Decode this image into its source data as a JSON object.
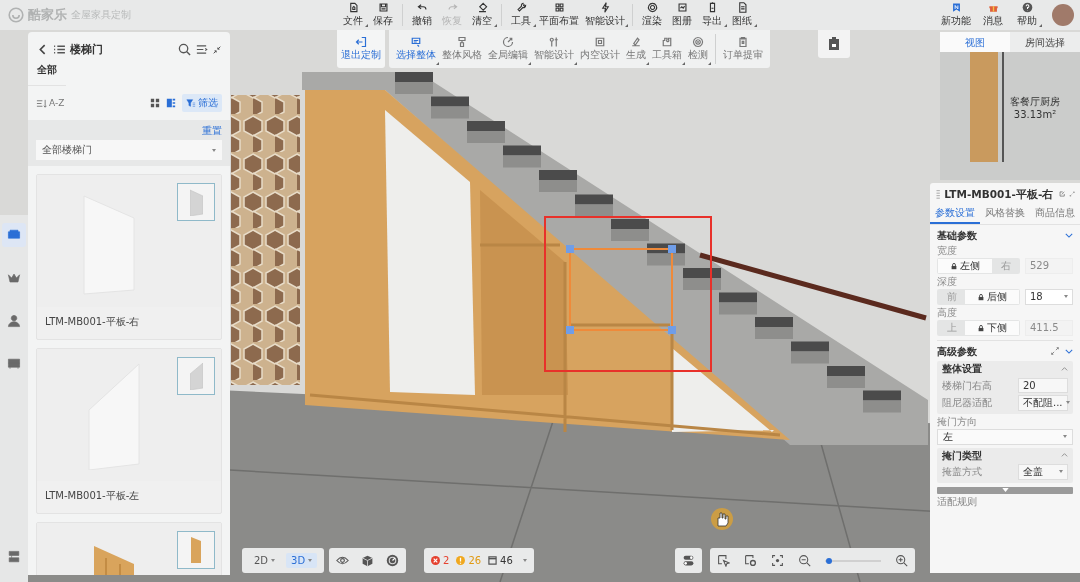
{
  "header": {
    "logo": "酷家乐",
    "subtitle": "全屋家具定制",
    "menu_groups": [
      [
        {
          "label": "文件",
          "disabled": false,
          "dropdown": true
        },
        {
          "label": "保存",
          "disabled": false,
          "dropdown": false
        }
      ],
      [
        {
          "label": "撤销",
          "disabled": false,
          "dropdown": false
        },
        {
          "label": "恢复",
          "disabled": true,
          "dropdown": false
        },
        {
          "label": "清空",
          "disabled": false,
          "dropdown": true
        }
      ],
      [
        {
          "label": "工具",
          "disabled": false,
          "dropdown": true
        },
        {
          "label": "平面布置",
          "disabled": false,
          "dropdown": false
        },
        {
          "label": "智能设计",
          "disabled": false,
          "dropdown": true
        }
      ],
      [
        {
          "label": "渲染",
          "disabled": false,
          "dropdown": false
        },
        {
          "label": "图册",
          "disabled": false,
          "dropdown": false
        },
        {
          "label": "导出",
          "disabled": false,
          "dropdown": true
        },
        {
          "label": "图纸",
          "disabled": false,
          "dropdown": true
        }
      ]
    ],
    "right_items": [
      {
        "label": "新功能",
        "dropdown": false
      },
      {
        "label": "消息",
        "dropdown": false
      },
      {
        "label": "帮助",
        "dropdown": true
      }
    ]
  },
  "custom_toolbar": {
    "exit": {
      "label": "退出定制"
    },
    "tools": [
      {
        "label": "选择整体",
        "selected": true,
        "dropdown": true
      },
      {
        "label": "整体风格",
        "selected": false,
        "dropdown": false
      },
      {
        "label": "全局编辑",
        "selected": false,
        "dropdown": true
      },
      {
        "label": "智能设计",
        "selected": false,
        "dropdown": true
      },
      {
        "label": "内空设计",
        "selected": false,
        "dropdown": false
      },
      {
        "label": "生成",
        "selected": false,
        "dropdown": true
      },
      {
        "label": "工具箱",
        "selected": false,
        "dropdown": true
      },
      {
        "label": "检测",
        "selected": false,
        "dropdown": true
      },
      {
        "label": "订单提审",
        "selected": false,
        "dropdown": false
      }
    ]
  },
  "view_tabs": [
    {
      "label": "视图",
      "selected": true
    },
    {
      "label": "房间选择",
      "selected": false
    }
  ],
  "minimap": {
    "room_name": "客餐厅厨房",
    "room_area": "33.13m²"
  },
  "left_rail": [
    {
      "selected": true
    },
    {
      "selected": false
    },
    {
      "selected": false
    },
    {
      "selected": false
    },
    {
      "selected": false
    }
  ],
  "library": {
    "title": "楼梯门",
    "breadcrumb": "全部",
    "sort": "A-Z",
    "layouts": [
      {
        "selected": false
      },
      {
        "selected": true
      }
    ],
    "filter": {
      "label": "筛选",
      "on": true
    },
    "reset": "重置",
    "category": "全部楼梯门",
    "products": [
      {
        "name": "LTM-MB001-平板-右",
        "kind": "panel-falling"
      },
      {
        "name": "LTM-MB001-平板-左",
        "kind": "panel-rising"
      },
      {
        "kind": "wood-door"
      }
    ]
  },
  "properties": {
    "title": "LTM-MB001-平板-右",
    "tabs": [
      {
        "label": "参数设置",
        "selected": true
      },
      {
        "label": "风格替换",
        "selected": false
      },
      {
        "label": "商品信息",
        "selected": false
      }
    ],
    "basic": {
      "title": "基础参数",
      "expanded": true,
      "params": [
        {
          "label": "宽度",
          "options": [
            {
              "label": "左侧",
              "selected": true
            },
            {
              "label": "右",
              "selected": false
            }
          ],
          "kind": "input",
          "value": "529",
          "disabled": true
        },
        {
          "label": "深度",
          "options": [
            {
              "label": "前",
              "selected": false
            },
            {
              "label": "后侧",
              "selected": true
            }
          ],
          "kind": "select",
          "value": "18",
          "disabled": false
        },
        {
          "label": "高度",
          "options": [
            {
              "label": "上",
              "selected": false
            },
            {
              "label": "下侧",
              "selected": true
            }
          ],
          "kind": "input",
          "value": "411.5",
          "disabled": true
        }
      ]
    },
    "advanced": {
      "title": "高级参数",
      "expanded": true,
      "items": [
        {
          "kind": "group",
          "title": "整体设置",
          "expanded": true,
          "fields": [
            {
              "label": "楼梯门右高",
              "kind": "input",
              "value": "20"
            },
            {
              "label": "阻尼器适配",
              "kind": "select",
              "value": "不配阻..."
            }
          ]
        },
        {
          "kind": "wide-select",
          "label": "掩门方向",
          "value": "左"
        },
        {
          "kind": "group",
          "title": "掩门类型",
          "expanded": true,
          "fields": [
            {
              "label": "掩盖方式",
              "kind": "select",
              "value": "全盖"
            }
          ]
        }
      ]
    },
    "footer_label": "适配规则"
  },
  "bottom_bar": {
    "views": [
      {
        "label": "2D",
        "selected": false
      },
      {
        "label": "3D",
        "selected": true
      }
    ],
    "issues": {
      "errors": "2",
      "warnings": "26",
      "items": "46"
    },
    "zoom": {
      "level": 0.08
    }
  }
}
